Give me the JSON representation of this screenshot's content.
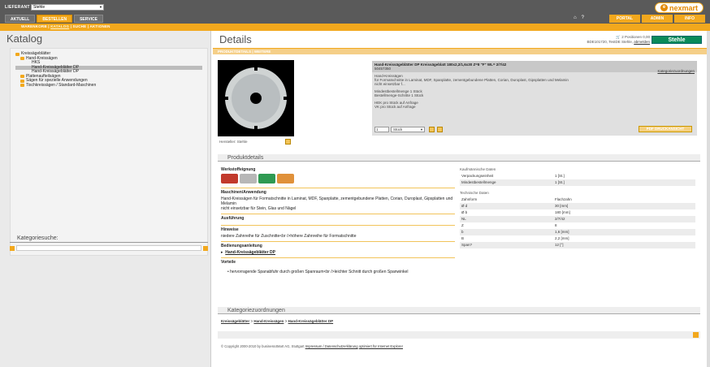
{
  "top": {
    "lieferant_label": "LIEFERANT",
    "lieferant_value": "Stehle",
    "tabs": [
      "AKTUELL",
      "BESTELLEN",
      "SERVICE"
    ],
    "active_tab": 1,
    "subnav": [
      "WARENKORB",
      "KATALOG",
      "SUCHE",
      "AKTIONEN"
    ],
    "links": [
      "PORTAL",
      "ADMIN",
      "INFO"
    ],
    "logo_text": "nexmart",
    "icons": [
      "home-icon",
      "help-icon"
    ]
  },
  "left": {
    "title": "Katalog",
    "tree": [
      {
        "label": "Kreissägeblätter",
        "level": 0,
        "icon": "folder-open-icon"
      },
      {
        "label": "Hand-Kreissägen",
        "level": 1,
        "icon": "folder-open-icon"
      },
      {
        "label": "HKS",
        "level": 2
      },
      {
        "label": "Hand-Kreissägeblätter DP",
        "level": 2,
        "selected": true
      },
      {
        "label": "Hand-Kreissägeblätter DP",
        "level": 2
      },
      {
        "label": "Plattenaufteilsägen",
        "level": 1,
        "icon": "folder-icon"
      },
      {
        "label": "Sägen für spezielle Anwendungen",
        "level": 1,
        "icon": "folder-icon"
      },
      {
        "label": "Tischkreissägen / Standard-Maschinen",
        "level": 1,
        "icon": "folder-icon"
      }
    ],
    "kategoriesuche": "Kategoriesuche:"
  },
  "main": {
    "title": "Details",
    "cart": "2 Positionen 0,00",
    "user": "BDE101720, TestDE Stehle,",
    "logout": "abmelden",
    "brand": "Stehle",
    "detail_tabs": "PRODUKTDETAILS | WEITERE",
    "hersteller": "Hersteller: Stehle",
    "info": {
      "title": "Hand-Kreissägeblätter DP Kreissägeblatt 180x2,2/1,6x30 Z=8 \"F\" WL= 2/7/42",
      "artno": "50457350",
      "link": "Kategoriezuordnungen",
      "desc_head": "Hand-Kreissägen",
      "desc": "für Formatschnitte in Laminat, MDF, Spanplatte, zementgebundene Platten, Corian, Duroplast, Gipsplatten und Melamin",
      "desc2": "nicht einsetzbar f...",
      "mindest": "Mindestbestellmenge    1 Stück",
      "schritte": "Bestellmenge-Schritte   1 Stück",
      "hek": "HEK pro Stück    auf Anfrage",
      "vk": "VK pro Stück    auf Anfrage",
      "qty": "1",
      "unit": "Stück",
      "pdf": "PDF DRUCKANSICHT"
    },
    "produktdetails": "Produktdetails",
    "werkstoffeignung": "Werkstoffeignung",
    "maschinen_title": "Maschinen/Anwendung",
    "maschinen_text": "Hand-Kreissägen für Formatschnitte in Laminat, MDF, Spanplatte, zementgebundene Platten, Corian, Duroplast, Gipsplatten und Melamin",
    "maschinen_text2": "nicht einsetzbar für Stein, Glas und Nägel",
    "ausfuehrung": "Ausführung",
    "hinweise_title": "Hinweise",
    "hinweise_text": "niedere Zahnreihe für Zuschnitte<br />höhere Zahnreihe für Formatschnitte",
    "bedienung_title": "Bedienungsanleitung",
    "bedienung_link": "Hand-Kreissägeblätter DP",
    "vorteile_title": "Vorteile",
    "vorteile_text": "hervorragende Spanabfuhr durch großen Spanraum<br />leichter Schnitt durch großen Spanwinkel",
    "kaufm_title": "Kaufmännische Daten",
    "kaufm": [
      [
        "Verpackungseinheit",
        "1 [St.]"
      ],
      [
        "Mindestbestellmenge",
        "1 [St.]"
      ]
    ],
    "tech_title": "Technische Daten",
    "tech": [
      [
        "Zahnform",
        "Flachzahn"
      ],
      [
        "Ø d",
        "30 [mm]"
      ],
      [
        "Ø b",
        "180 [mm]"
      ],
      [
        "NL",
        "2/7/42"
      ],
      [
        "Z",
        "8"
      ],
      [
        "b",
        "1,6 [mm]"
      ],
      [
        "B",
        "2,2 [mm]"
      ],
      [
        "Span?",
        "12 [°]"
      ]
    ],
    "kategoriezuordnungen": "Kategoriezuordnungen",
    "breadcrumb": [
      "Kreissägeblätter",
      "Hand-Kreissägen",
      "Hand-Kreissägeblätter DP"
    ],
    "copyright": "© Copyright 2000-2010 by business4Mart AG, Stuttgart",
    "impressum": "Impressum / Datenschutzerklärung",
    "optimiert": "optimiert für Internet Explorer"
  }
}
